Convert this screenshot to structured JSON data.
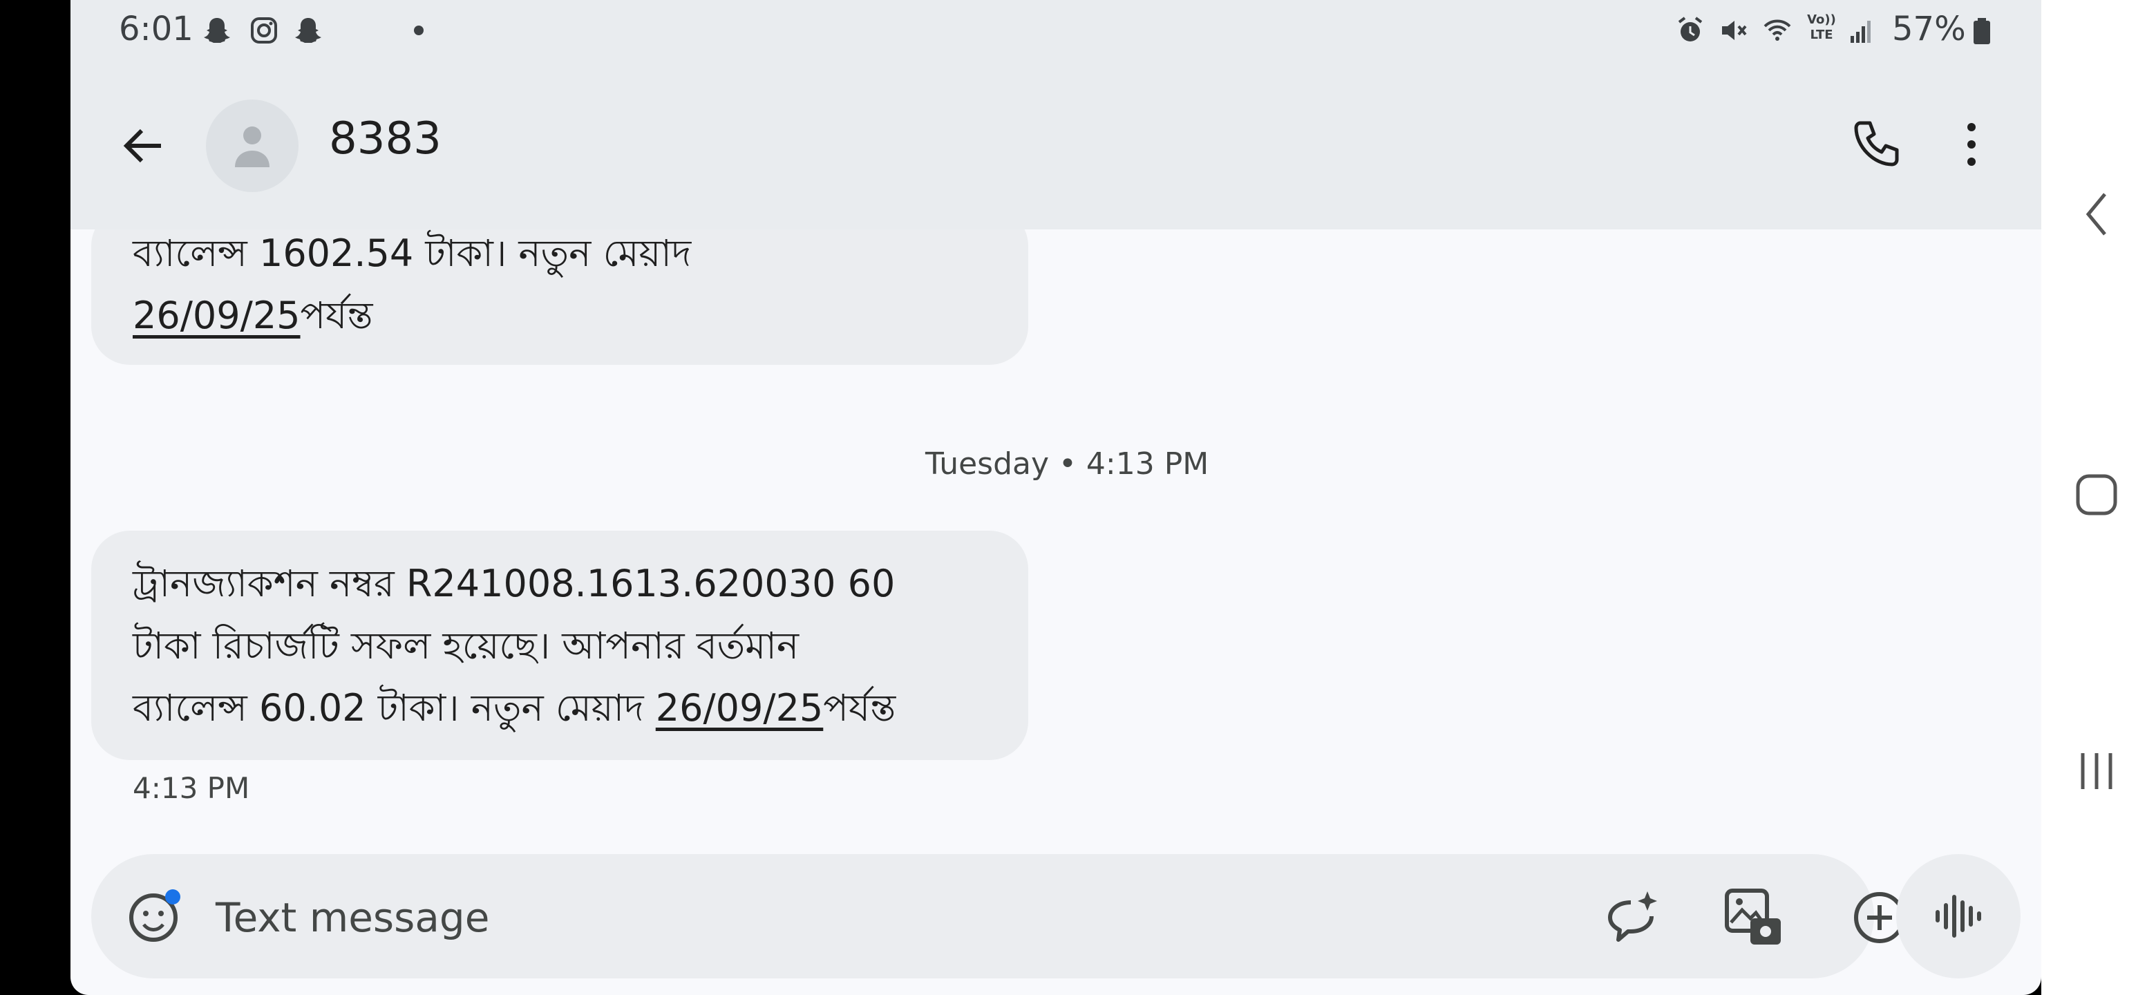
{
  "status_bar": {
    "time": "6:01",
    "left_icons": [
      "snapchat-icon",
      "instagram-icon",
      "snapchat-icon",
      "notification-dot"
    ],
    "right_icons": [
      "alarm-icon",
      "mute-icon",
      "wifi-icon",
      "volte-icon",
      "signal-icon"
    ],
    "volte_text": "Vo)) LTE",
    "battery_text": "57%"
  },
  "header": {
    "contact_name": "8383",
    "back_icon": "arrow-back-icon",
    "call_icon": "phone-icon",
    "more_icon": "more-vert-icon"
  },
  "messages": {
    "first": {
      "line1": "ব্যালেন্স 1602.54 টাকা। নতুন মেয়াদ",
      "date": "26/09/25",
      "line2_suffix": "পর্যন্ত"
    },
    "separator": "Tuesday • 4:13 PM",
    "second": {
      "line1": "ট্রানজ্যাকশন নম্বর R241008.1613.620030 60",
      "line2": "টাকা রিচার্জটি সফল হয়েছে। আপনার বর্তমান",
      "line3_prefix": "ব্যালেন্স 60.02 টাকা। নতুন মেয়াদ ",
      "date": "26/09/25",
      "line3_suffix": "পর্যন্ত"
    },
    "timestamp": "4:13 PM"
  },
  "composer": {
    "placeholder": "Text message",
    "icons": [
      "emoji-icon",
      "ai-suggest-icon",
      "gallery-icon",
      "add-icon",
      "voice-icon"
    ]
  },
  "nav_bar": {
    "icons": [
      "nav-back-icon",
      "nav-home-icon",
      "nav-recents-icon"
    ]
  },
  "colors": {
    "header_bg": "#e9ecef",
    "bubble_bg": "#ebedf0",
    "page_bg": "#f8f9fc",
    "emoji_badge": "#1a73e8"
  }
}
